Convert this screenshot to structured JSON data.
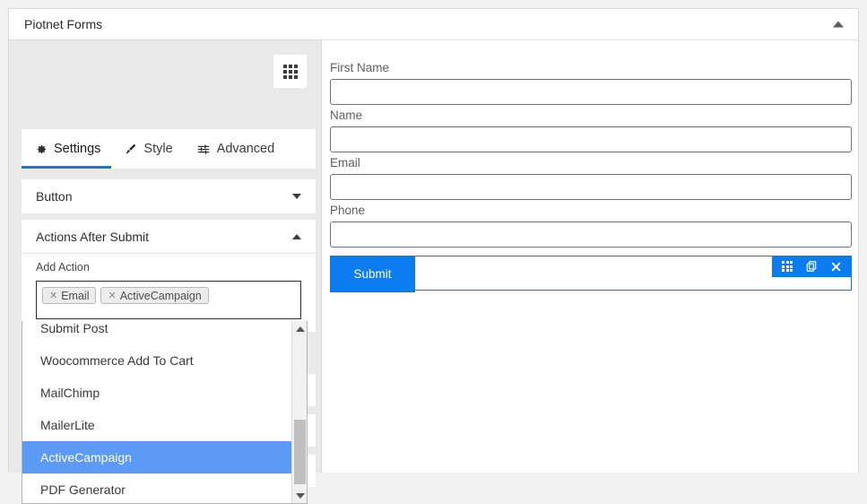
{
  "window": {
    "title": "Piotnet Forms",
    "collapse_icon": "chevron-up-icon"
  },
  "editor": {
    "grid_button_icon": "grid-icon",
    "tabs": [
      {
        "label": "Settings",
        "icon": "gear-icon",
        "active": true
      },
      {
        "label": "Style",
        "icon": "paintbrush-icon",
        "active": false
      },
      {
        "label": "Advanced",
        "icon": "sliders-icon",
        "active": false
      }
    ],
    "sections": [
      {
        "label": "Button",
        "state": "collapsed",
        "icon": "caret-down-icon"
      },
      {
        "label": "Actions After Submit",
        "state": "expanded",
        "icon": "caret-up-icon"
      }
    ],
    "add_action": {
      "label": "Add Action",
      "chips": [
        {
          "remove_icon": "close-icon",
          "label": "Email"
        },
        {
          "remove_icon": "close-icon",
          "label": "ActiveCampaign"
        }
      ],
      "dropdown": {
        "open": true,
        "selected": "ActiveCampaign",
        "options": [
          "Submit Post",
          "Woocommerce Add To Cart",
          "MailChimp",
          "MailerLite",
          "ActiveCampaign",
          "PDF Generator"
        ],
        "scroll_up_icon": "triangle-up-icon",
        "scroll_down_icon": "triangle-down-icon"
      }
    }
  },
  "preview": {
    "fields": [
      {
        "label": "First Name",
        "value": "",
        "placeholder": ""
      },
      {
        "label": "Name",
        "value": "",
        "placeholder": ""
      },
      {
        "label": "Email",
        "value": "",
        "placeholder": ""
      },
      {
        "label": "Phone",
        "value": "",
        "placeholder": ""
      }
    ],
    "submit_label": "Submit",
    "element_toolbar": [
      {
        "icon": "grid-icon",
        "name": "edit-element"
      },
      {
        "icon": "duplicate-icon",
        "name": "duplicate-element"
      },
      {
        "icon": "close-icon",
        "name": "delete-element"
      }
    ]
  },
  "colors": {
    "accent_blue": "#0c7cf0",
    "tab_underline": "#1e73d6",
    "highlight_blue": "#5b9bf5",
    "panel_bg": "#e9e9e9",
    "card_bg": "#ffffff"
  }
}
